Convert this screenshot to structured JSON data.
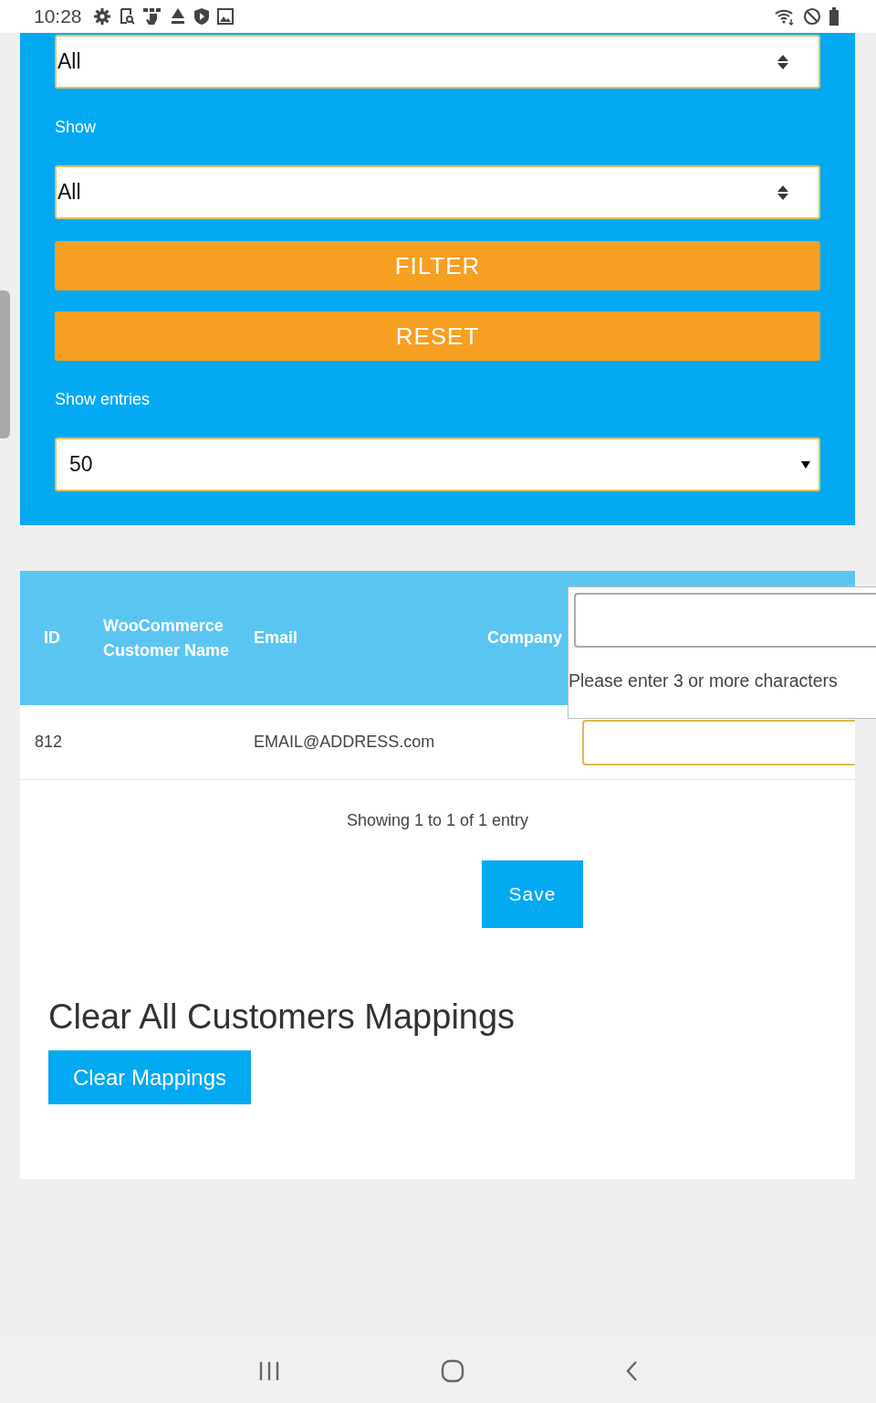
{
  "status_bar": {
    "time": "10:28"
  },
  "filter_panel": {
    "type_select": {
      "value": "All"
    },
    "show_label": "Show",
    "show_select": {
      "value": "All"
    },
    "filter_button": "FILTER",
    "reset_button": "RESET",
    "entries_label": "Show entries",
    "entries_select": {
      "value": "50"
    }
  },
  "table": {
    "columns": [
      "ID",
      "WooCommerce Customer Name",
      "Email",
      "Company"
    ],
    "rows": [
      {
        "id": "812",
        "email": "EMAIL@ADDRESS.com"
      }
    ],
    "search_dropdown": {
      "message": "Please enter 3 or more characters"
    },
    "info": "Showing 1 to 1 of 1 entry"
  },
  "save_button": "Save",
  "clear_section": {
    "heading": "Clear All Customers Mappings",
    "button": "Clear Mappings"
  }
}
